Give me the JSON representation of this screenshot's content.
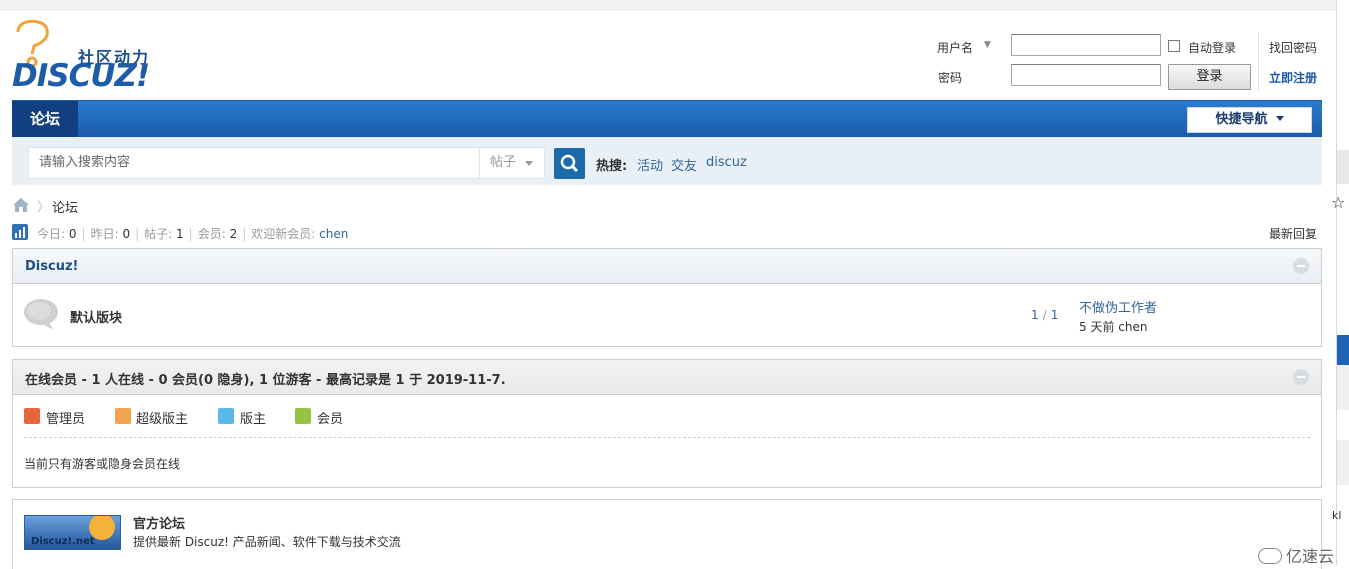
{
  "logo": {
    "slogan": "社区动力",
    "text": "DISCUZ!"
  },
  "login": {
    "username_label": "用户名",
    "password_label": "密码",
    "autologin_label": "自动登录",
    "login_button": "登录",
    "forgot_password": "找回密码",
    "register": "立即注册"
  },
  "nav": {
    "forum": "论坛",
    "quick_nav": "快捷导航"
  },
  "search": {
    "placeholder": "请输入搜索内容",
    "type": "帖子",
    "hot_label": "热搜:",
    "hot_items": [
      "活动",
      "交友",
      "discuz"
    ]
  },
  "breadcrumb": {
    "separator": "〉",
    "current": "论坛"
  },
  "stats": {
    "today_label": "今日:",
    "today": "0",
    "yesterday_label": "昨日:",
    "yesterday": "0",
    "posts_label": "帖子:",
    "posts": "1",
    "members_label": "会员:",
    "members": "2",
    "welcome_label": "欢迎新会员:",
    "new_member": "chen",
    "latest_reply": "最新回复"
  },
  "group": {
    "title": "Discuz!",
    "forum": {
      "name": "默认版块",
      "threads": "1",
      "posts": "1",
      "last_title": "不做伪工作者",
      "last_meta": "5 天前 chen"
    }
  },
  "online": {
    "title": "在线会员 - 1 人在线 - 0 会员(0 隐身), 1 位游客 - 最高记录是 1 于 2019-11-7.",
    "legend": [
      "管理员",
      "超级版主",
      "版主",
      "会员"
    ],
    "message": "当前只有游客或隐身会员在线"
  },
  "official": {
    "logo_text": "Discuz!.net",
    "title": "官方论坛",
    "desc": "提供最新 Discuz! 产品新闻、软件下载与技术交流"
  },
  "watermark": "亿速云",
  "edge_text": "kl",
  "colors": {
    "nav_blue": "#1a5ca8",
    "link": "#336699",
    "brand": "#1f5ca8"
  }
}
